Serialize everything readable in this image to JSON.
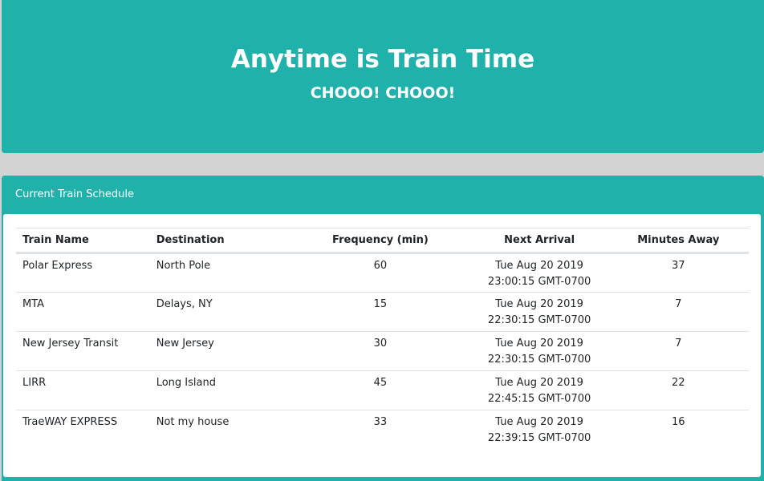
{
  "jumbotron": {
    "title": "Anytime is Train Time",
    "subtitle": "CHOOO! CHOOO!"
  },
  "schedule": {
    "header": "Current Train Schedule",
    "columns": [
      "Train Name",
      "Destination",
      "Frequency (min)",
      "Next Arrival",
      "Minutes Away"
    ],
    "rows": [
      {
        "name": "Polar Express",
        "destination": "North Pole",
        "frequency": "60",
        "next_arrival": "Tue Aug 20 2019 23:00:15 GMT-0700",
        "minutes_away": "37"
      },
      {
        "name": "MTA",
        "destination": "Delays, NY",
        "frequency": "15",
        "next_arrival": "Tue Aug 20 2019 22:30:15 GMT-0700",
        "minutes_away": "7"
      },
      {
        "name": "New Jersey Transit",
        "destination": "New Jersey",
        "frequency": "30",
        "next_arrival": "Tue Aug 20 2019 22:30:15 GMT-0700",
        "minutes_away": "7"
      },
      {
        "name": "LIRR",
        "destination": "Long Island",
        "frequency": "45",
        "next_arrival": "Tue Aug 20 2019 22:45:15 GMT-0700",
        "minutes_away": "22"
      },
      {
        "name": "TraeWAY EXPRESS",
        "destination": "Not my house",
        "frequency": "33",
        "next_arrival": "Tue Aug 20 2019 22:39:15 GMT-0700",
        "minutes_away": "16"
      }
    ]
  },
  "colors": {
    "accent": "#20b2aa",
    "page_background": "#d3d3d3"
  }
}
